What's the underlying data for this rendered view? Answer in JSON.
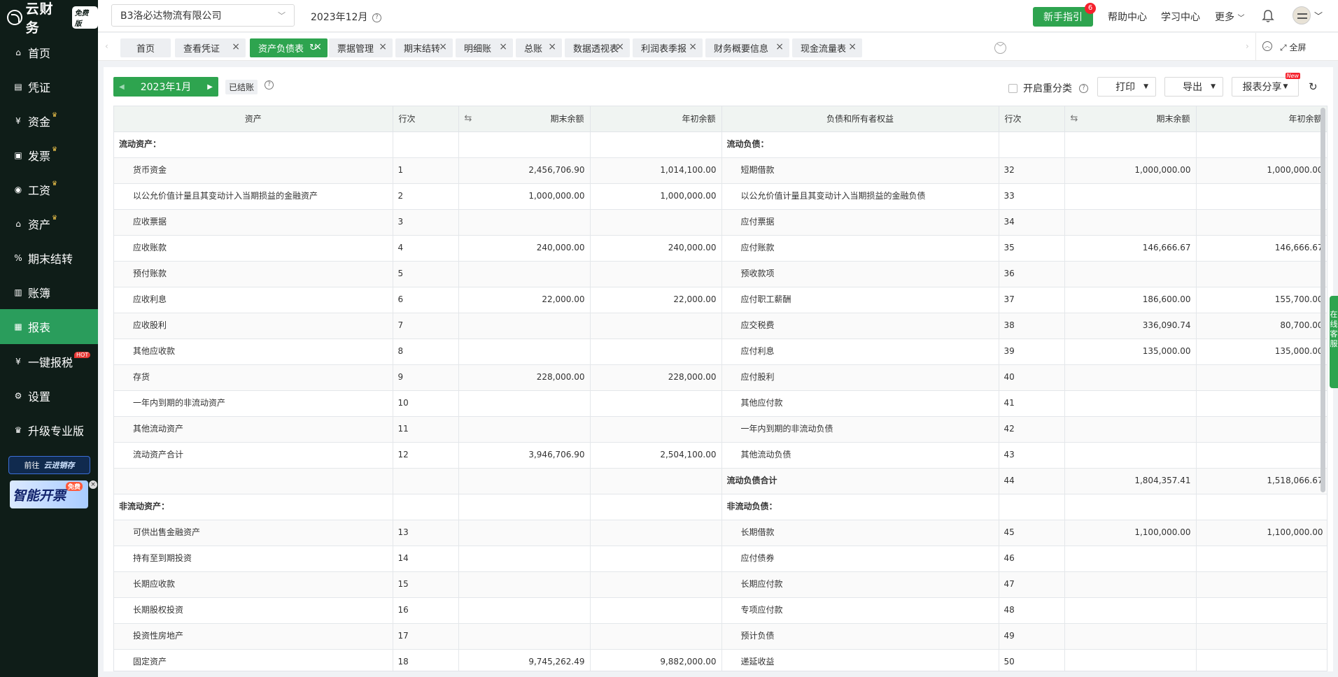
{
  "brand": {
    "name": "云财务",
    "edition": "免费版"
  },
  "sidebar": {
    "items": [
      {
        "icon": "home-icon",
        "glyph": "⌂",
        "label": "首页",
        "crown": false
      },
      {
        "icon": "voucher-icon",
        "glyph": "▤",
        "label": "凭证",
        "crown": false
      },
      {
        "icon": "money-icon",
        "glyph": "¥",
        "label": "资金",
        "crown": true
      },
      {
        "icon": "invoice-icon",
        "glyph": "▣",
        "label": "发票",
        "crown": true
      },
      {
        "icon": "salary-icon",
        "glyph": "◉",
        "label": "工资",
        "crown": true
      },
      {
        "icon": "asset-icon",
        "glyph": "⌂",
        "label": "资产",
        "crown": true
      },
      {
        "icon": "period-close-icon",
        "glyph": "%",
        "label": "期末结转",
        "crown": false
      },
      {
        "icon": "ledger-icon",
        "glyph": "▥",
        "label": "账簿",
        "crown": false
      },
      {
        "icon": "report-icon",
        "glyph": "▦",
        "label": "报表",
        "crown": false,
        "active": true
      },
      {
        "icon": "tax-icon",
        "glyph": "¥",
        "label": "一键报税",
        "crown": false,
        "hot": "HOT"
      },
      {
        "icon": "settings-icon",
        "glyph": "⚙",
        "label": "设置",
        "crown": false
      },
      {
        "icon": "upgrade-crown-icon",
        "glyph": "♛",
        "label": "升级专业版",
        "crown": false
      }
    ]
  },
  "promo": {
    "goto": "前往",
    "brand2": "云进销存",
    "invoice_text": "智能开票",
    "invoice_tag": "免费"
  },
  "header": {
    "company": "B3洛必达物流有限公司",
    "period": "2023年12月",
    "guide": "新手指引",
    "guide_badge": "6",
    "help": "帮助中心",
    "learn": "学习中心",
    "more": "更多"
  },
  "tabs": [
    {
      "label": "首页",
      "closable": false
    },
    {
      "label": "查看凭证",
      "closable": true
    },
    {
      "label": "资产负债表",
      "closable": true,
      "active": true
    },
    {
      "label": "票据管理",
      "closable": true
    },
    {
      "label": "期末结转",
      "closable": true
    },
    {
      "label": "明细账",
      "closable": true
    },
    {
      "label": "总账",
      "closable": true
    },
    {
      "label": "数据透视表",
      "closable": true
    },
    {
      "label": "利润表季报",
      "closable": true
    },
    {
      "label": "财务概要信息",
      "closable": true
    },
    {
      "label": "现金流量表",
      "closable": true
    }
  ],
  "fullscreen": "全屏",
  "toolbar": {
    "month": "2023年1月",
    "status": "已结账",
    "reclass": "开启重分类",
    "print": "打印",
    "export": "导出",
    "share": "报表分享",
    "share_new": "New"
  },
  "table": {
    "headers": [
      "资产",
      "行次",
      "期末余额",
      "年初余额",
      "负债和所有者权益",
      "行次",
      "期末余额",
      "年初余额"
    ],
    "rows": [
      {
        "a": "流动资产：",
        "asec": true,
        "an": "",
        "ae": "",
        "ab": "",
        "l": "流动负债：",
        "lsec": true,
        "ln": "",
        "le": "",
        "lb": ""
      },
      {
        "a": "货币资金",
        "an": "1",
        "ae": "2,456,706.90",
        "ab": "1,014,100.00",
        "l": "短期借款",
        "ln": "32",
        "le": "1,000,000.00",
        "lb": "1,000,000.00"
      },
      {
        "a": "以公允价值计量且其变动计入当期损益的金融资产",
        "an": "2",
        "ae": "1,000,000.00",
        "ab": "1,000,000.00",
        "l": "以公允价值计量且其变动计入当期损益的金融负债",
        "ln": "33",
        "le": "",
        "lb": ""
      },
      {
        "a": "应收票据",
        "an": "3",
        "ae": "",
        "ab": "",
        "l": "应付票据",
        "ln": "34",
        "le": "",
        "lb": ""
      },
      {
        "a": "应收账款",
        "an": "4",
        "ae": "240,000.00",
        "ab": "240,000.00",
        "l": "应付账款",
        "ln": "35",
        "le": "146,666.67",
        "lb": "146,666.67"
      },
      {
        "a": "预付账款",
        "an": "5",
        "ae": "",
        "ab": "",
        "l": "预收款项",
        "ln": "36",
        "le": "",
        "lb": ""
      },
      {
        "a": "应收利息",
        "an": "6",
        "ae": "22,000.00",
        "ab": "22,000.00",
        "l": "应付职工薪酬",
        "ln": "37",
        "le": "186,600.00",
        "lb": "155,700.00"
      },
      {
        "a": "应收股利",
        "an": "7",
        "ae": "",
        "ab": "",
        "l": "应交税费",
        "ln": "38",
        "le": "336,090.74",
        "lb": "80,700.00"
      },
      {
        "a": "其他应收款",
        "an": "8",
        "ae": "",
        "ab": "",
        "l": "应付利息",
        "ln": "39",
        "le": "135,000.00",
        "lb": "135,000.00"
      },
      {
        "a": "存货",
        "an": "9",
        "ae": "228,000.00",
        "ab": "228,000.00",
        "l": "应付股利",
        "ln": "40",
        "le": "",
        "lb": ""
      },
      {
        "a": "一年内到期的非流动资产",
        "an": "10",
        "ae": "",
        "ab": "",
        "l": "其他应付款",
        "ln": "41",
        "le": "",
        "lb": ""
      },
      {
        "a": "其他流动资产",
        "an": "11",
        "ae": "",
        "ab": "",
        "l": "一年内到期的非流动负债",
        "ln": "42",
        "le": "",
        "lb": ""
      },
      {
        "a": "流动资产合计",
        "an": "12",
        "ae": "3,946,706.90",
        "ab": "2,504,100.00",
        "l": "其他流动负债",
        "ln": "43",
        "le": "",
        "lb": ""
      },
      {
        "a": "",
        "an": "",
        "ae": "",
        "ab": "",
        "l": "流动负债合计",
        "ltot": true,
        "ln": "44",
        "le": "1,804,357.41",
        "lb": "1,518,066.67"
      },
      {
        "a": "非流动资产：",
        "asec": true,
        "an": "",
        "ae": "",
        "ab": "",
        "l": "非流动负债：",
        "lsec": true,
        "ln": "",
        "le": "",
        "lb": ""
      },
      {
        "a": "可供出售金融资产",
        "an": "13",
        "ae": "",
        "ab": "",
        "l": "长期借款",
        "ln": "45",
        "le": "1,100,000.00",
        "lb": "1,100,000.00"
      },
      {
        "a": "持有至到期投资",
        "an": "14",
        "ae": "",
        "ab": "",
        "l": "应付债券",
        "ln": "46",
        "le": "",
        "lb": ""
      },
      {
        "a": "长期应收款",
        "an": "15",
        "ae": "",
        "ab": "",
        "l": "长期应付款",
        "ln": "47",
        "le": "",
        "lb": ""
      },
      {
        "a": "长期股权投资",
        "an": "16",
        "ae": "",
        "ab": "",
        "l": "专项应付款",
        "ln": "48",
        "le": "",
        "lb": ""
      },
      {
        "a": "投资性房地产",
        "an": "17",
        "ae": "",
        "ab": "",
        "l": "预计负债",
        "ln": "49",
        "le": "",
        "lb": ""
      },
      {
        "a": "固定资产",
        "an": "18",
        "ae": "9,745,262.49",
        "ab": "9,882,000.00",
        "l": "递延收益",
        "ln": "50",
        "le": "",
        "lb": ""
      }
    ]
  },
  "chat": "在线客服"
}
